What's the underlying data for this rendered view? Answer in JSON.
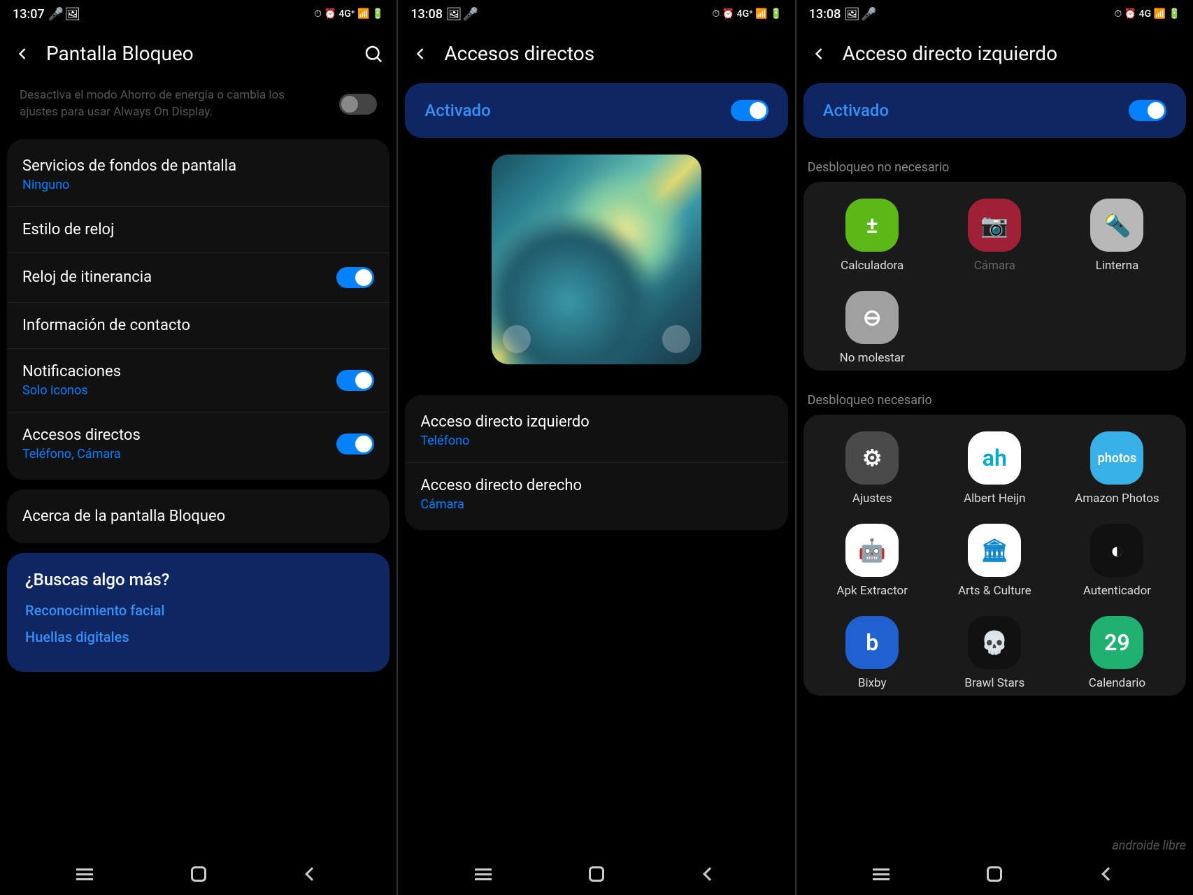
{
  "screen1": {
    "time": "13:07",
    "title": "Pantalla Bloqueo",
    "disabled_text": "Desactiva el modo Ahorro de energía o cambia los ajustes para usar Always On Display.",
    "items": {
      "wallpaper": {
        "title": "Servicios de fondos de pantalla",
        "sub": "Ninguno"
      },
      "clock_style": {
        "title": "Estilo de reloj"
      },
      "roaming_clock": {
        "title": "Reloj de itinerancia"
      },
      "contact_info": {
        "title": "Información de contacto"
      },
      "notifications": {
        "title": "Notificaciones",
        "sub": "Solo iconos"
      },
      "shortcuts": {
        "title": "Accesos directos",
        "sub": "Teléfono, Cámara"
      },
      "about": {
        "title": "Acerca de la pantalla Bloqueo"
      }
    },
    "tip": {
      "title": "¿Buscas algo más?",
      "link1": "Reconocimiento facial",
      "link2": "Huellas digitales"
    }
  },
  "screen2": {
    "time": "13:08",
    "title": "Accesos directos",
    "activado": "Activado",
    "left": {
      "title": "Acceso directo izquierdo",
      "sub": "Teléfono"
    },
    "right": {
      "title": "Acceso directo derecho",
      "sub": "Cámara"
    }
  },
  "screen3": {
    "time": "13:08",
    "title": "Acceso directo izquierdo",
    "activado": "Activado",
    "group1": "Desbloqueo no necesario",
    "group2": "Desbloqueo necesario",
    "apps_no_unlock": [
      {
        "label": "Calculadora",
        "bg": "#5cb818",
        "emoji": "±"
      },
      {
        "label": "Cámara",
        "bg": "#a02038",
        "emoji": "📷",
        "dim": true
      },
      {
        "label": "Linterna",
        "bg": "#b8b8b8",
        "emoji": "🔦"
      },
      {
        "label": "No molestar",
        "bg": "#a0a0a0",
        "emoji": "⊖"
      }
    ],
    "apps_unlock": [
      {
        "label": "Ajustes",
        "bg": "#4a4a4a",
        "emoji": "⚙"
      },
      {
        "label": "Albert Heijn",
        "bg": "#ffffff",
        "emoji": "ah",
        "fg": "#0ac"
      },
      {
        "label": "Amazon Photos",
        "bg": "#38b0e8",
        "emoji": "photos"
      },
      {
        "label": "Apk Extractor",
        "bg": "#ffffff",
        "emoji": "🤖",
        "fg": "#3c3"
      },
      {
        "label": "Arts & Culture",
        "bg": "#ffffff",
        "emoji": "🏛",
        "fg": "#18c"
      },
      {
        "label": "Autenticador",
        "bg": "#111111",
        "emoji": "◐"
      },
      {
        "label": "Bixby",
        "bg": "#2060d0",
        "emoji": "b"
      },
      {
        "label": "Brawl Stars",
        "bg": "#111111",
        "emoji": "💀",
        "fg": "#fc0"
      },
      {
        "label": "Calendario",
        "bg": "#20b070",
        "emoji": "29"
      }
    ],
    "watermark": "androide libre"
  }
}
